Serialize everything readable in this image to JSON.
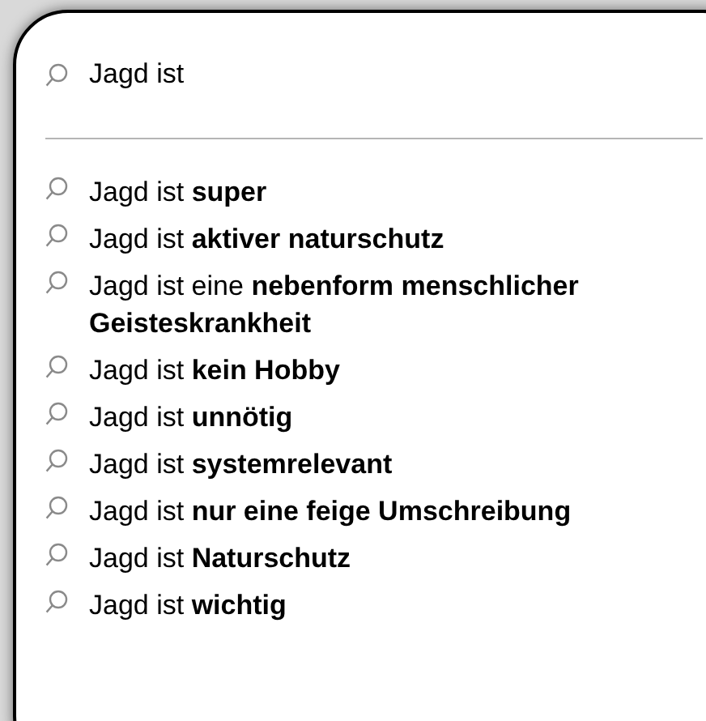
{
  "search": {
    "value": "Jagd ist"
  },
  "suggestions": [
    {
      "text": "Jagd ist **super**"
    },
    {
      "text": "Jagd ist **aktiver naturschutz**"
    },
    {
      "text": "Jagd ist eine **nebenform menschlicher Geisteskrankheit**"
    },
    {
      "text": "Jagd ist **kein Hobby**"
    },
    {
      "text": "Jagd ist **unnötig**"
    },
    {
      "text": "Jagd ist **systemrelevant**"
    },
    {
      "text": "Jagd ist **nur eine feige Umschreibung**"
    },
    {
      "text": "Jagd ist **Naturschutz**"
    },
    {
      "text": "Jagd ist **wichtig**"
    }
  ]
}
